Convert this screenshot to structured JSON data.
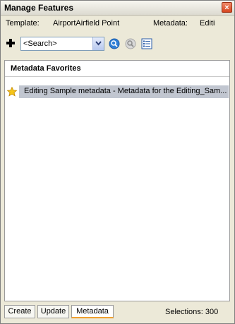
{
  "window": {
    "title": "Manage Features",
    "close_glyph": "×"
  },
  "template_row": {
    "template_label": "Template:",
    "template_value": "AirportAirfield Point",
    "metadata_label": "Metadata:",
    "metadata_value": "Editi"
  },
  "toolbar": {
    "add_icon": "plus-icon",
    "search_value": "<Search>",
    "search_button_icon": "search-icon",
    "clear_button_icon": "clear-search-icon",
    "details_button_icon": "details-list-icon"
  },
  "favorites": {
    "header": "Metadata Favorites",
    "items": [
      {
        "label": "Editing Sample metadata - Metadata for the Editing_Sam...",
        "icon": "star-icon"
      }
    ]
  },
  "tabs": [
    {
      "label": "Create",
      "active": false
    },
    {
      "label": "Update",
      "active": false
    },
    {
      "label": "Metadata",
      "active": true
    }
  ],
  "status": {
    "selections": "Selections: 300"
  },
  "colors": {
    "selected_row": "#c1c6d0",
    "active_tab_accent": "#f0a030",
    "close_button": "#d6451f"
  }
}
